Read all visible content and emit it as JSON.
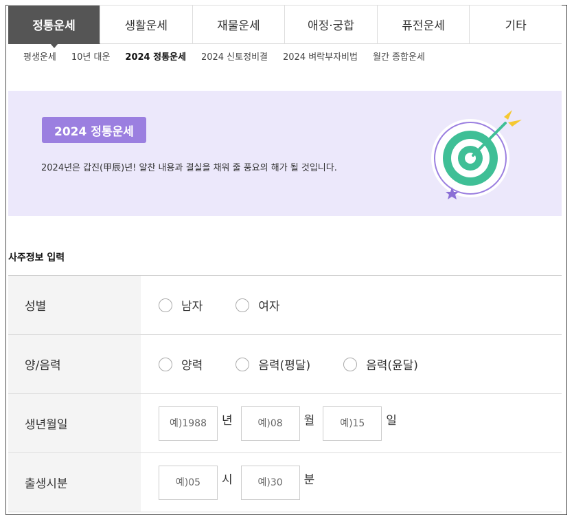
{
  "tabs": [
    {
      "label": "정통운세",
      "active": true
    },
    {
      "label": "생활운세"
    },
    {
      "label": "재물운세"
    },
    {
      "label": "애정·궁합"
    },
    {
      "label": "퓨전운세"
    },
    {
      "label": "기타"
    }
  ],
  "subnav": [
    {
      "label": "평생운세"
    },
    {
      "label": "10년 대운"
    },
    {
      "label": "2024 정통운세",
      "active": true
    },
    {
      "label": "2024 신토정비결"
    },
    {
      "label": "2024 벼락부자비법"
    },
    {
      "label": "월간 종합운세"
    }
  ],
  "banner": {
    "badge": "2024 정통운세",
    "description": "2024년은 갑진(甲辰)년! 알찬 내용과 결실을 채워 줄 풍요의 해가 될 것입니다.",
    "icon": "target-arrow-icon",
    "bg_color": "#ece8fb",
    "badge_color": "#9b7fe0"
  },
  "form": {
    "title": "사주정보 입력",
    "gender": {
      "label": "성별",
      "options": [
        "남자",
        "여자"
      ]
    },
    "calendar": {
      "label": "양/음력",
      "options": [
        "양력",
        "음력(평달)",
        "음력(윤달)"
      ]
    },
    "birthdate": {
      "label": "생년월일",
      "year_placeholder": "예)1988",
      "year_unit": "년",
      "month_placeholder": "예)08",
      "month_unit": "월",
      "day_placeholder": "예)15",
      "day_unit": "일"
    },
    "birthtime": {
      "label": "출생시분",
      "hour_placeholder": "예)05",
      "hour_unit": "시",
      "minute_placeholder": "예)30",
      "minute_unit": "분"
    }
  }
}
